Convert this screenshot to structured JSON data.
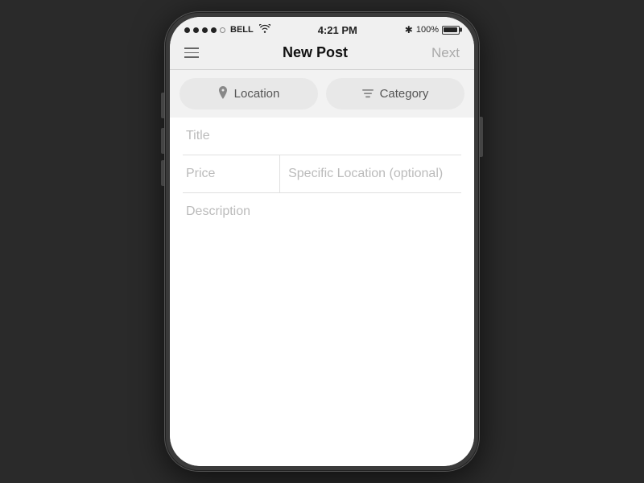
{
  "status_bar": {
    "signal_dots": [
      {
        "filled": true
      },
      {
        "filled": true
      },
      {
        "filled": true
      },
      {
        "filled": true
      },
      {
        "filled": false
      }
    ],
    "carrier": "BELL",
    "wifi": "wifi",
    "time": "4:21 PM",
    "bluetooth": "✱",
    "battery_percent": "100%"
  },
  "nav": {
    "title": "New Post",
    "next_label": "Next"
  },
  "pill_buttons": {
    "location_icon": "📍",
    "location_label": "Location",
    "category_icon": "☰",
    "category_label": "Category"
  },
  "form": {
    "title_placeholder": "Title",
    "price_label": "Price",
    "specific_location_placeholder": "Specific Location (optional)",
    "description_placeholder": "Description"
  }
}
